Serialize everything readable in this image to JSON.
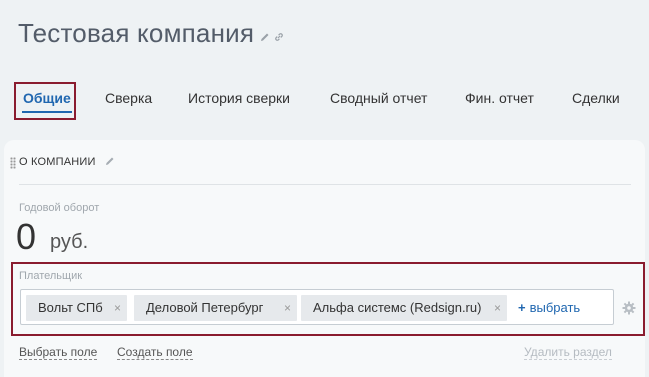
{
  "header": {
    "title": "Тестовая компания",
    "edit_icon": "pencil-icon",
    "link_icon": "link-icon"
  },
  "tabs": [
    {
      "label": "Общие",
      "active": true
    },
    {
      "label": "Сверка",
      "active": false
    },
    {
      "label": "История сверки",
      "active": false
    },
    {
      "label": "Сводный отчет",
      "active": false
    },
    {
      "label": "Фин. отчет",
      "active": false
    },
    {
      "label": "Сделки",
      "active": false
    }
  ],
  "section": {
    "title": "О КОМПАНИИ",
    "turnover": {
      "label": "Годовой оборот",
      "value": "0",
      "currency": "руб."
    },
    "payer": {
      "label": "Плательщик",
      "chips": [
        {
          "label": "Вольт СПб"
        },
        {
          "label": "Деловой Петербург"
        },
        {
          "label": "Альфа системс (Redsign.ru)"
        }
      ],
      "remove_glyph": "×",
      "add_label": "выбрать",
      "add_glyph": "+"
    },
    "actions": {
      "choose_field": "Выбрать поле",
      "create_field": "Создать поле",
      "delete_section": "Удалить раздел"
    }
  },
  "colors": {
    "accent": "#2067b0",
    "highlight": "#8a1c2f",
    "background": "#eef2f4",
    "card": "#f7f9fa",
    "chip": "#e6e9ec"
  }
}
